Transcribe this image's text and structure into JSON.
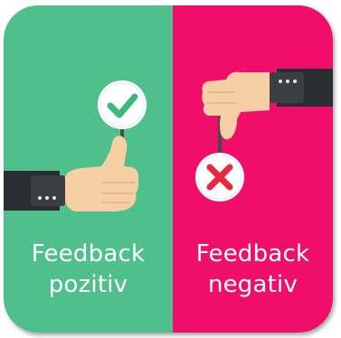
{
  "colors": {
    "positive_bg": "#4fc08b",
    "negative_bg": "#ef0e6a",
    "check_green": "#3cb878",
    "cross_red": "#e8283f",
    "sleeve": "#2b2d30",
    "skin": "#f6cfa4"
  },
  "icons": {
    "positive": "thumbs-up-icon",
    "negative": "thumbs-down-icon",
    "check": "check-icon",
    "cross": "cross-icon"
  },
  "positive": {
    "line1": "Feedback",
    "line2": "pozitiv"
  },
  "negative": {
    "line1": "Feedback",
    "line2": "negativ"
  }
}
